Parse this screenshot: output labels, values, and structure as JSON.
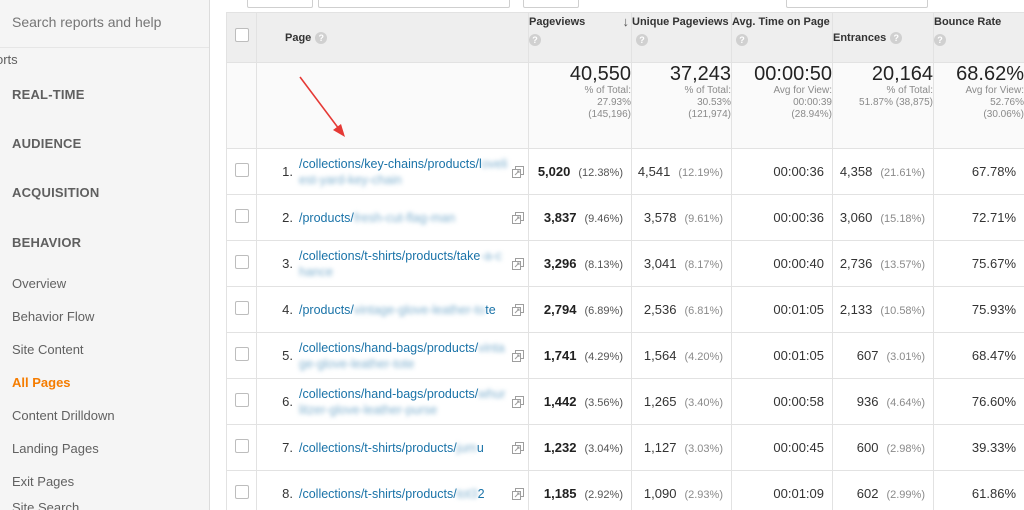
{
  "sidebar": {
    "search_placeholder": "Search reports and help",
    "reports_label": "orts",
    "sections": [
      {
        "label": "REAL-TIME"
      },
      {
        "label": "AUDIENCE"
      },
      {
        "label": "ACQUISITION"
      },
      {
        "label": "BEHAVIOR"
      }
    ],
    "behavior_items": [
      {
        "label": "Overview"
      },
      {
        "label": "Behavior Flow"
      },
      {
        "label": "Site Content"
      },
      {
        "label": "All Pages",
        "active": true
      },
      {
        "label": "Content Drilldown"
      },
      {
        "label": "Landing Pages"
      },
      {
        "label": "Exit Pages"
      }
    ],
    "partial_item": "Site Search"
  },
  "table": {
    "headers": {
      "page": "Page",
      "pageviews": "Pageviews",
      "unique": "Unique Pageviews",
      "avg_time": "Avg. Time on Page",
      "entrances": "Entrances",
      "bounce": "Bounce Rate"
    },
    "totals": {
      "pageviews": {
        "big": "40,550",
        "l1": "% of Total:",
        "l2": "27.93%",
        "l3": "(145,196)"
      },
      "unique": {
        "big": "37,243",
        "l1": "% of Total:",
        "l2": "30.53%",
        "l3": "(121,974)"
      },
      "avg_time": {
        "big": "00:00:50",
        "l1": "Avg for View:",
        "l2": "00:00:39",
        "l3": "(28.94%)"
      },
      "entrances": {
        "big": "20,164",
        "l1": "% of Total:",
        "l2": "51.87% (38,875)"
      },
      "bounce": {
        "big": "68.62%",
        "l1": "Avg for View:",
        "l2": "52.76%",
        "l3": "(30.06%)"
      }
    },
    "rows": [
      {
        "rank": "1.",
        "path": "/collections/key-chains/products/l",
        "path_blur": "oveliest-yard-key-chain",
        "pageviews": "5,020",
        "pv_pct": "(12.38%)",
        "unique": "4,541",
        "u_pct": "(12.19%)",
        "avg_time": "00:00:36",
        "entrances": "4,358",
        "e_pct": "(21.61%)",
        "bounce": "67.78%"
      },
      {
        "rank": "2.",
        "path": "/products/",
        "path_blur": "fresh-cut-flag-man",
        "pageviews": "3,837",
        "pv_pct": "(9.46%)",
        "unique": "3,578",
        "u_pct": "(9.61%)",
        "avg_time": "00:00:36",
        "entrances": "3,060",
        "e_pct": "(15.18%)",
        "bounce": "72.71%"
      },
      {
        "rank": "3.",
        "path": "/collections/t-shirts/products/take",
        "path_blur": "-a-chance",
        "pageviews": "3,296",
        "pv_pct": "(8.13%)",
        "unique": "3,041",
        "u_pct": "(8.17%)",
        "avg_time": "00:00:40",
        "entrances": "2,736",
        "e_pct": "(13.57%)",
        "bounce": "75.67%"
      },
      {
        "rank": "4.",
        "path": "/products/",
        "path_blur": "vintage-glove-leather-to",
        "path_tail": "te",
        "pageviews": "2,794",
        "pv_pct": "(6.89%)",
        "unique": "2,536",
        "u_pct": "(6.81%)",
        "avg_time": "00:01:05",
        "entrances": "2,133",
        "e_pct": "(10.58%)",
        "bounce": "75.93%"
      },
      {
        "rank": "5.",
        "path": "/collections/hand-bags/products/",
        "path_blur": "vintage-glove-leather-tote",
        "pageviews": "1,741",
        "pv_pct": "(4.29%)",
        "unique": "1,564",
        "u_pct": "(4.20%)",
        "avg_time": "00:01:05",
        "entrances": "607",
        "e_pct": "(3.01%)",
        "bounce": "68.47%"
      },
      {
        "rank": "6.",
        "path": "/collections/hand-bags/products/",
        "path_blur": "whurlitzer-glove-leather-purse",
        "pageviews": "1,442",
        "pv_pct": "(3.56%)",
        "unique": "1,265",
        "u_pct": "(3.40%)",
        "avg_time": "00:00:58",
        "entrances": "936",
        "e_pct": "(4.64%)",
        "bounce": "76.60%"
      },
      {
        "rank": "7.",
        "path": "/collections/t-shirts/products/",
        "path_blur": "jum",
        "path_tail": "u",
        "pageviews": "1,232",
        "pv_pct": "(3.04%)",
        "unique": "1,127",
        "u_pct": "(3.03%)",
        "avg_time": "00:00:45",
        "entrances": "600",
        "e_pct": "(2.98%)",
        "bounce": "39.33%"
      },
      {
        "rank": "8.",
        "path": "/collections/t-shirts/products/",
        "path_blur": "tot3",
        "path_tail": "2",
        "pageviews": "1,185",
        "pv_pct": "(2.92%)",
        "unique": "1,090",
        "u_pct": "(2.93%)",
        "avg_time": "00:01:09",
        "entrances": "602",
        "e_pct": "(2.99%)",
        "bounce": "61.86%"
      }
    ]
  },
  "colors": {
    "active": "#f57c00",
    "link": "#1a73a8",
    "annotation_arrow": "#e53935"
  }
}
